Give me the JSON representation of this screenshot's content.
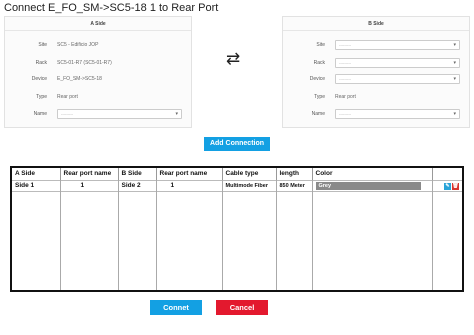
{
  "title": "Connect E_FO_SM->SC5-18 1 to Rear Port",
  "a_side": {
    "header": "A Side",
    "site_label": "Site",
    "site_value": "SC5 - Edificio JOP",
    "rack_label": "Rack",
    "rack_value": "SC5-01-R7 (SC5-01-R7)",
    "device_label": "Device",
    "device_value": "E_FO_SM->SC5-18",
    "type_label": "Type",
    "type_value": "Rear port",
    "name_label": "Name",
    "name_placeholder": "---------"
  },
  "b_side": {
    "header": "B Side",
    "site_label": "Site",
    "site_placeholder": "---------",
    "rack_label": "Rack",
    "rack_placeholder": "---------",
    "device_label": "Device",
    "device_placeholder": "---------",
    "type_label": "Type",
    "type_value": "Rear port",
    "name_label": "Name",
    "name_placeholder": "---------"
  },
  "swap_icon": "⇄",
  "add_button": "Add Connection",
  "table": {
    "headers": [
      "A Side",
      "Rear port name",
      "B Side",
      "Rear port name",
      "Cable type",
      "length",
      "Color",
      ""
    ],
    "rows": [
      {
        "a_side": "Side 1",
        "a_port": "1",
        "b_side": "Side 2",
        "b_port": "1",
        "cable": "Multimode Fiber",
        "length": "850 Meter",
        "color": "Grey"
      }
    ]
  },
  "icons": {
    "edit": "edit-icon",
    "delete": "trash-icon"
  },
  "colors": {
    "primary": "#13a0e3",
    "danger": "#e3192e",
    "grey": "#8a8a8a"
  },
  "buttons": {
    "connect": "Connet",
    "cancel": "Cancel"
  }
}
